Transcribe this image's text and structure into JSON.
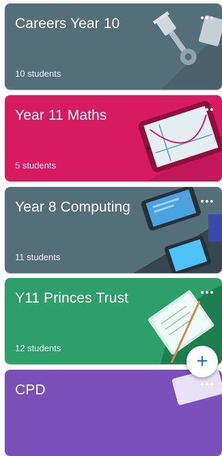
{
  "classes": [
    {
      "title": "Careers Year 10",
      "students": "10 students",
      "color": "#546e7a"
    },
    {
      "title": "Year 11 Maths",
      "students": "5 students",
      "color": "#d81b60"
    },
    {
      "title": "Year 8 Computing",
      "students": "11 students",
      "color": "#546e7a"
    },
    {
      "title": "Y11 Princes Trust",
      "students": "12 students",
      "color": "#2e9f6b"
    },
    {
      "title": "CPD",
      "students": "",
      "color": "#7b4fb8"
    }
  ],
  "fab": {
    "label": "+",
    "icon": "plus-icon"
  },
  "icons": {
    "more": "more-horiz-icon"
  }
}
